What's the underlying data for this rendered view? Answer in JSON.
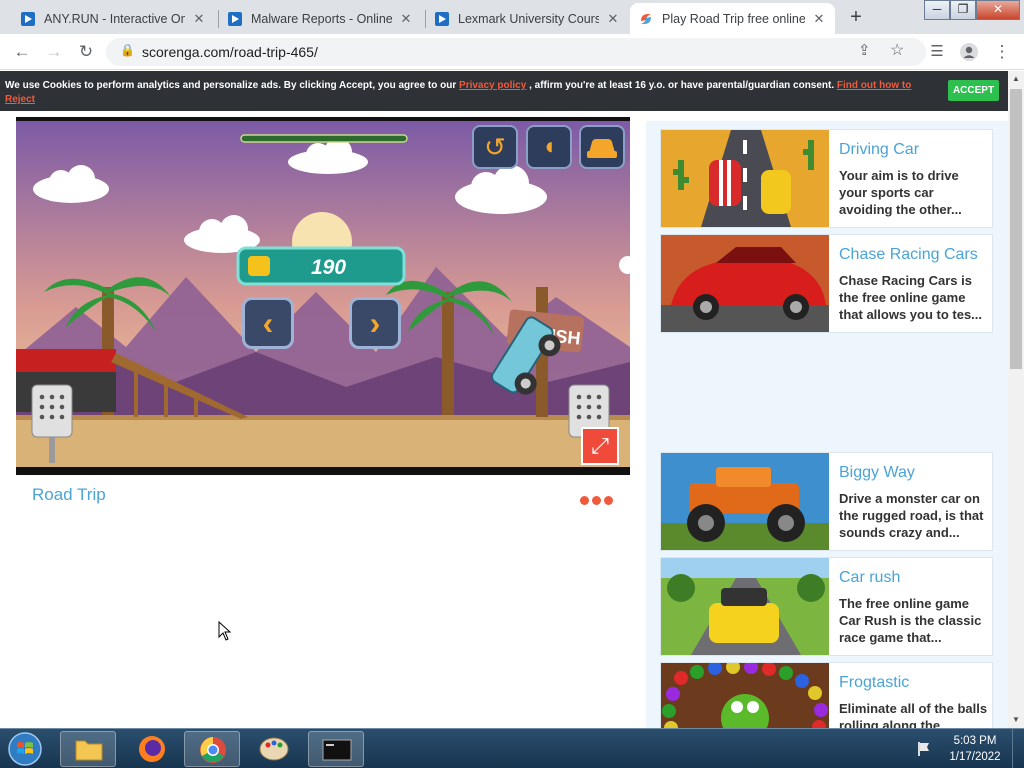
{
  "browser": {
    "tabs": [
      {
        "title": "ANY.RUN - Interactive Onl",
        "active": false
      },
      {
        "title": "Malware Reports - Online",
        "active": false
      },
      {
        "title": "Lexmark University Course",
        "active": false
      },
      {
        "title": "Play Road Trip free online g",
        "active": true
      }
    ],
    "close_glyph": "✕",
    "new_tab_glyph": "+",
    "url": "scorenga.com/road-trip-465/",
    "window_buttons": {
      "minimize": "─",
      "restore": "❐",
      "close": "✕"
    }
  },
  "cookie_bar": {
    "text_1": "We use Cookies to perform analytics and personalize ads. By clicking Accept, you agree to our ",
    "privacy_link": "Privacy policy",
    "text_2": " , affirm you're at least 16 y.o. or have parental/guardian consent. ",
    "reject_link": "Find out how to Reject",
    "accept_label": "ACCEPT"
  },
  "game": {
    "title": "Road Trip",
    "coin_count": "190",
    "sign_text": "RUSH"
  },
  "sidebar": {
    "cards": [
      {
        "title": "Driving Car",
        "desc": "Your aim is to drive your sports car avoiding the other..."
      },
      {
        "title": "Chase Racing Cars",
        "desc": "Chase Racing Cars is the free online game that allows you to tes..."
      },
      {
        "title": "Biggy Way",
        "desc": "Drive a monster car on the rugged road, is that sounds crazy and..."
      },
      {
        "title": "Car rush",
        "desc": "The free online game Car Rush is the classic race game that..."
      },
      {
        "title": "Frogtastic",
        "desc": "Eliminate all of the balls rolling along the"
      }
    ]
  },
  "taskbar": {
    "time": "5:03 PM",
    "date": "1/17/2022"
  }
}
